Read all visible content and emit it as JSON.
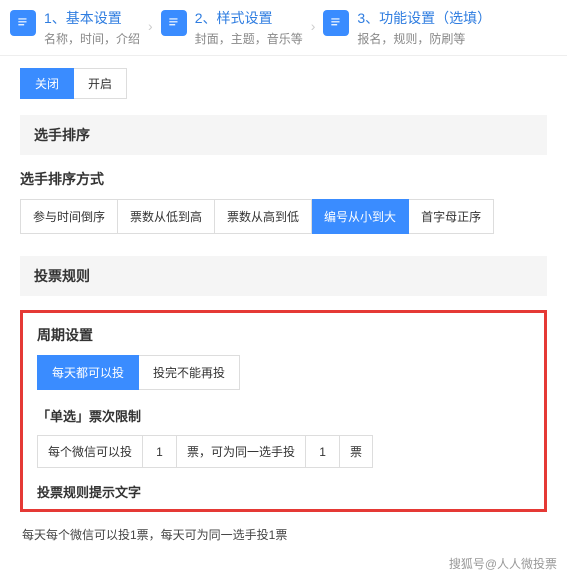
{
  "steps": [
    {
      "title": "1、基本设置",
      "sub": "名称，时间，介绍"
    },
    {
      "title": "2、样式设置",
      "sub": "封面，主题，音乐等"
    },
    {
      "title": "3、功能设置（选填）",
      "sub": "报名，规则，防刷等"
    }
  ],
  "toggle": {
    "off": "关闭",
    "on": "开启"
  },
  "sections": {
    "sort_header": "选手排序",
    "sort_label": "选手排序方式",
    "sort_options": [
      "参与时间倒序",
      "票数从低到高",
      "票数从高到低",
      "编号从小到大",
      "首字母正序"
    ],
    "rules_header": "投票规则",
    "cycle_label": "周期设置",
    "cycle_options": [
      "每天都可以投",
      "投完不能再投"
    ],
    "limit_label": "「单选」票次限制",
    "limit_cells": {
      "c1": "每个微信可以投",
      "v1": "1",
      "c2": "票，可为同一选手投",
      "v2": "1",
      "c3": "票"
    },
    "hint_label": "投票规则提示文字",
    "hint_text": "每天每个微信可以投1票，每天可为同一选手投1票"
  },
  "watermark": "搜狐号@人人微投票"
}
